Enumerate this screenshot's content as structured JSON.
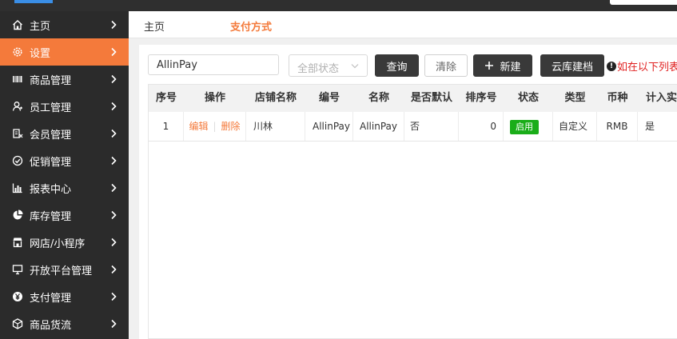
{
  "colors": {
    "accent": "#f47a3b",
    "sidebar_bg": "#2b2b2b",
    "enabled_badge": "#1aad19",
    "notice": "#e02020"
  },
  "sidebar": {
    "items": [
      {
        "label": "主页",
        "icon": "home-icon",
        "active": false
      },
      {
        "label": "设置",
        "icon": "gear-icon",
        "active": true
      },
      {
        "label": "商品管理",
        "icon": "barcode-icon",
        "active": false
      },
      {
        "label": "员工管理",
        "icon": "employee-icon",
        "active": false
      },
      {
        "label": "会员管理",
        "icon": "member-icon",
        "active": false
      },
      {
        "label": "促销管理",
        "icon": "check-circle-icon",
        "active": false
      },
      {
        "label": "报表中心",
        "icon": "bar-chart-icon",
        "active": false
      },
      {
        "label": "库存管理",
        "icon": "pie-chart-icon",
        "active": false
      },
      {
        "label": "网店/小程序",
        "icon": "store-icon",
        "active": false
      },
      {
        "label": "开放平台管理",
        "icon": "monitor-icon",
        "active": false
      },
      {
        "label": "支付管理",
        "icon": "yuan-icon",
        "active": false
      },
      {
        "label": "商品货流",
        "icon": "cube-icon",
        "active": false
      }
    ]
  },
  "breadcrumb": {
    "home": "主页",
    "current": "支付方式"
  },
  "toolbar": {
    "search_value": "AllinPay",
    "status_placeholder": "全部状态",
    "query_label": "查询",
    "clear_label": "清除",
    "new_label": "新建",
    "cloud_label": "云库建档",
    "notice_text": "如在以下列表"
  },
  "table": {
    "headers": [
      "序号",
      "操作",
      "店铺名称",
      "编号",
      "名称",
      "是否默认",
      "排序号",
      "状态",
      "类型",
      "币种",
      "计入实"
    ],
    "rows": [
      {
        "index": "1",
        "edit": "编辑",
        "delete": "删除",
        "store": "川林",
        "code": "AllinPay",
        "name": "AllinPay",
        "is_default": "否",
        "sort": "0",
        "status": "启用",
        "type": "自定义",
        "currency": "RMB",
        "count_in": "是"
      }
    ]
  }
}
